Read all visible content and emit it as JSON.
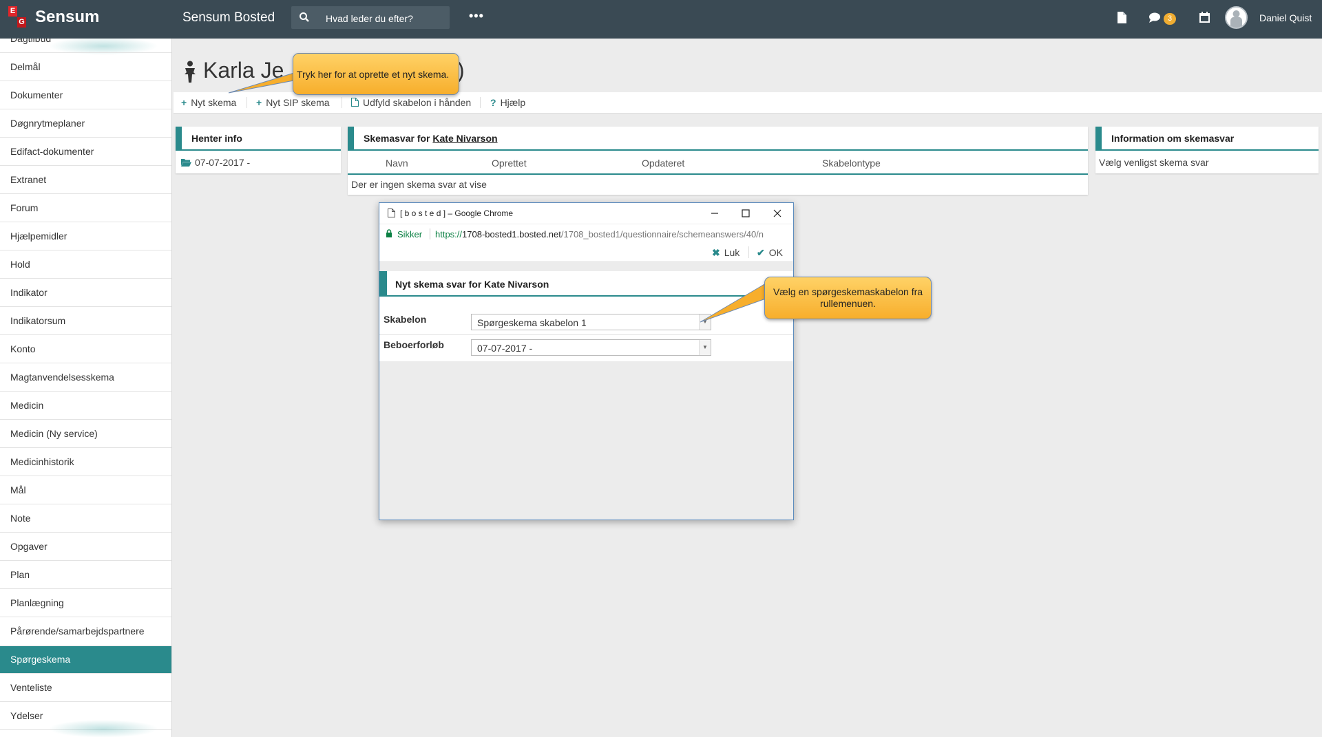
{
  "topbar": {
    "logo_letters": [
      "E",
      "G"
    ],
    "brand": "Sensum",
    "app_name": "Sensum Bosted",
    "search_placeholder": "Hvad leder du efter?",
    "more": "•••",
    "message_count": "3",
    "user_name": "Daniel Quist",
    "bar_color": "#3a4a54"
  },
  "sidebar": {
    "items": [
      {
        "label": "Dagtilbud"
      },
      {
        "label": "Delmål"
      },
      {
        "label": "Dokumenter"
      },
      {
        "label": "Døgnrytmeplaner"
      },
      {
        "label": "Edifact-dokumenter"
      },
      {
        "label": "Extranet"
      },
      {
        "label": "Forum"
      },
      {
        "label": "Hjælpemidler"
      },
      {
        "label": "Hold"
      },
      {
        "label": "Indikator"
      },
      {
        "label": "Indikatorsum"
      },
      {
        "label": "Konto"
      },
      {
        "label": "Magtanvendelsesskema"
      },
      {
        "label": "Medicin"
      },
      {
        "label": "Medicin (Ny service)"
      },
      {
        "label": "Medicinhistorik"
      },
      {
        "label": "Mål"
      },
      {
        "label": "Note"
      },
      {
        "label": "Opgaver"
      },
      {
        "label": "Plan"
      },
      {
        "label": "Planlægning"
      },
      {
        "label": "Pårørende/samarbejdspartnere"
      },
      {
        "label": "Spørgeskema"
      },
      {
        "label": "Venteliste"
      },
      {
        "label": "Ydelser"
      }
    ],
    "active_label": "Spørgeskema",
    "accent": "#2a8a8c"
  },
  "page": {
    "title_visible": "Karla Je",
    "title_end": ")"
  },
  "toolbar": {
    "new_scheme": "Nyt skema",
    "new_sip_scheme": "Nyt SIP skema",
    "fill_template_by_hand": "Udfyld skabelon i hånden",
    "help": "Hjælp"
  },
  "panels": {
    "henter": {
      "title": "Henter info",
      "item": "07-07-2017 -"
    },
    "schema": {
      "title_prefix": "Skemasvar for",
      "person": "Kate Nivarson",
      "columns": [
        "Navn",
        "Oprettet",
        "Opdateret",
        "Skabelontype"
      ],
      "empty_text": "Der er ingen skema svar at vise"
    },
    "info": {
      "title": "Information om skemasvar",
      "text": "Vælg venligst skema svar"
    }
  },
  "popup": {
    "window_title": "[ b o s t e d ] – Google Chrome",
    "secure_label": "Sikker",
    "url_scheme": "https://",
    "url_host": "1708-bosted1.bosted.net",
    "url_path": "/1708_bosted1/questionnaire/schemeanswers/40/n",
    "close_label": "Luk",
    "ok_label": "OK",
    "panel_title": "Nyt skema svar for Kate Nivarson",
    "fields": [
      {
        "label": "Skabelon",
        "value": "Spørgeskema skabelon 1"
      },
      {
        "label": "Beboerforløb",
        "value": "07-07-2017 -"
      }
    ]
  },
  "tooltips": {
    "new_scheme_hint": "Tryk her for at oprette et nyt skema.",
    "template_hint_line1": "Vælg en spørgeskemaskabelon fra",
    "template_hint_line2": "rullemenuen."
  }
}
